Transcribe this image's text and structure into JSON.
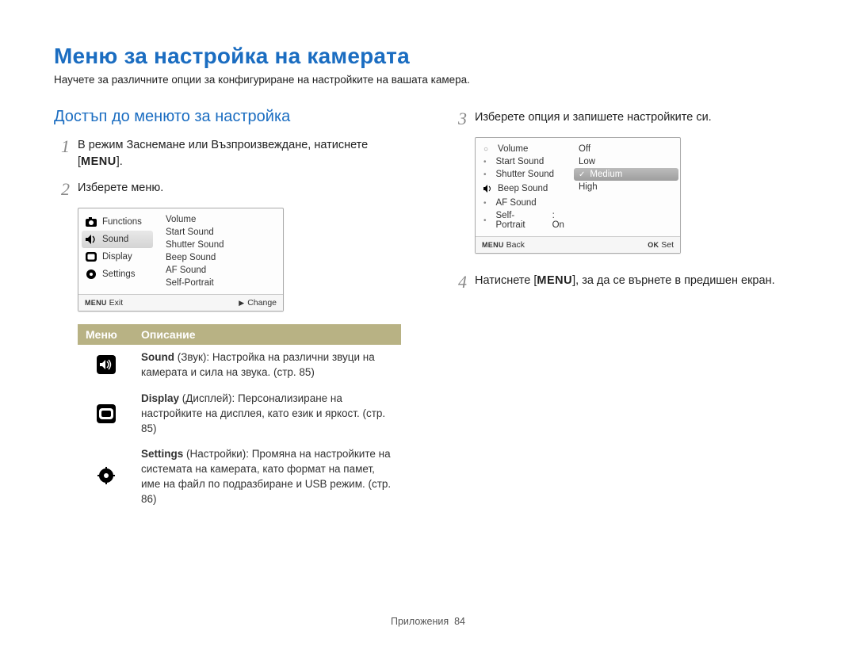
{
  "title": "Меню за настройка на камерата",
  "intro": "Научете за различните опции за конфигуриране на настройките на вашата камера.",
  "subtitle": "Достъп до менюто за настройка",
  "steps": {
    "s1_a": "В режим Заснемане или Възпроизвеждане, натиснете [",
    "s1_menu": "MENU",
    "s1_b": "].",
    "s2": "Изберете меню.",
    "s3": "Изберете опция и запишете настройките си.",
    "s4_a": "Натиснете [",
    "s4_menu": "MENU",
    "s4_b": "], за да се върнете в предишен екран."
  },
  "screen1": {
    "left": [
      "Functions",
      "Sound",
      "Display",
      "Settings"
    ],
    "right": [
      "Volume",
      "Start Sound",
      "Shutter Sound",
      "Beep Sound",
      "AF Sound",
      "Self-Portrait"
    ],
    "footer_left_label": "MENU",
    "footer_left_text": "Exit",
    "footer_right_text": "Change"
  },
  "screen2": {
    "left": [
      "Volume",
      "Start Sound",
      "Shutter Sound",
      "Beep Sound",
      "AF Sound",
      "Self-Portrait"
    ],
    "left_extra_value": ": On",
    "right": [
      "Off",
      "Low",
      "Medium",
      "High"
    ],
    "selected": "Medium",
    "footer_left_label": "MENU",
    "footer_left_text": "Back",
    "footer_right_label": "OK",
    "footer_right_text": "Set"
  },
  "table": {
    "head_menu": "Меню",
    "head_desc": "Описание",
    "rows": [
      {
        "icon": "sound-icon",
        "bold": "Sound",
        "rest": " (Звук): Настройка на различни звуци на камерата и сила на звука. (стр. 85)"
      },
      {
        "icon": "display-icon",
        "bold": "Display",
        "rest": " (Дисплей): Персонализиране на настройките на дисплея, като език и яркост. (стр. 85)"
      },
      {
        "icon": "settings-icon",
        "bold": "Settings",
        "rest": " (Настройки): Промяна на настройките на системата на камерата, като формат на памет, име на файл по подразбиране и USB режим. (стр. 86)"
      }
    ]
  },
  "footer": {
    "label": "Приложения",
    "page": "84"
  }
}
